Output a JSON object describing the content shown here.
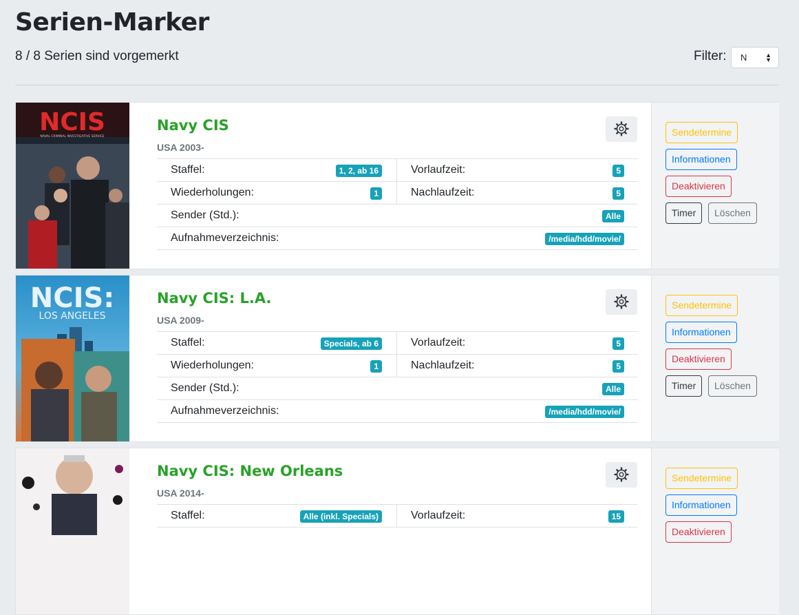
{
  "header": {
    "title": "Serien-Marker",
    "subtitle": "8 / 8 Serien sind vorgemerkt",
    "filter_label": "Filter:",
    "filter_value": "N"
  },
  "labels": {
    "staffel": "Staffel:",
    "vorlauf": "Vorlaufzeit:",
    "wiederholungen": "Wiederholungen:",
    "nachlauf": "Nachlaufzeit:",
    "sender": "Sender (Std.):",
    "aufnahme": "Aufnahmeverzeichnis:"
  },
  "buttons": {
    "sendetermine": "Sendetermine",
    "informationen": "Informationen",
    "deaktivieren": "Deaktivieren",
    "timer": "Timer",
    "loeschen": "Löschen"
  },
  "series": [
    {
      "title": "Navy CIS",
      "year": "USA 2003-",
      "poster_text": "NCIS",
      "poster_subtext": "NAVAL CRIMINAL INVESTIGATIVE SERVICE",
      "staffel": "1, 2, ab 16",
      "vorlauf": "5",
      "wiederholungen": "1",
      "nachlauf": "5",
      "sender": "Alle",
      "aufnahme": "/media/hdd/movie/"
    },
    {
      "title": "Navy CIS: L.A.",
      "year": "USA 2009-",
      "poster_text": "NCIS:",
      "poster_subtext": "LOS ANGELES",
      "staffel": "Specials, ab 6",
      "vorlauf": "5",
      "wiederholungen": "1",
      "nachlauf": "5",
      "sender": "Alle",
      "aufnahme": "/media/hdd/movie/"
    },
    {
      "title": "Navy CIS: New Orleans",
      "year": "USA 2014-",
      "staffel": "Alle (inkl. Specials)",
      "vorlauf": "15"
    }
  ],
  "colors": {
    "accent_title": "#28a228",
    "badge": "#17a2b8"
  }
}
